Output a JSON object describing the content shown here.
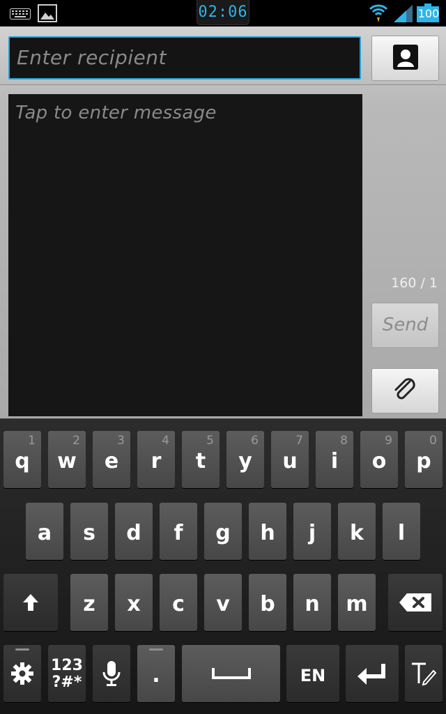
{
  "status_bar": {
    "time": "02:06",
    "battery": "100",
    "icons": [
      "keyboard-icon",
      "image-icon",
      "wifi-icon",
      "signal-icon",
      "battery-icon"
    ]
  },
  "compose": {
    "recipient_placeholder": "Enter recipient",
    "message_placeholder": "Tap to enter message",
    "char_counter": "160 / 1",
    "send_label": "Send",
    "contact_icon": "contact-icon",
    "attach_icon": "paperclip-icon"
  },
  "keyboard": {
    "row1": [
      {
        "label": "q",
        "hint": "1"
      },
      {
        "label": "w",
        "hint": "2"
      },
      {
        "label": "e",
        "hint": "3"
      },
      {
        "label": "r",
        "hint": "4"
      },
      {
        "label": "t",
        "hint": "5"
      },
      {
        "label": "y",
        "hint": "6"
      },
      {
        "label": "u",
        "hint": "7"
      },
      {
        "label": "i",
        "hint": "8"
      },
      {
        "label": "o",
        "hint": "9"
      },
      {
        "label": "p",
        "hint": "0"
      }
    ],
    "row2": [
      "a",
      "s",
      "d",
      "f",
      "g",
      "h",
      "j",
      "k",
      "l"
    ],
    "row3": [
      "z",
      "x",
      "c",
      "v",
      "b",
      "n",
      "m"
    ],
    "symbols_label": "123\n?#*",
    "period_label": ".",
    "language_label": "EN",
    "accent_color": "#2fb4e8"
  }
}
